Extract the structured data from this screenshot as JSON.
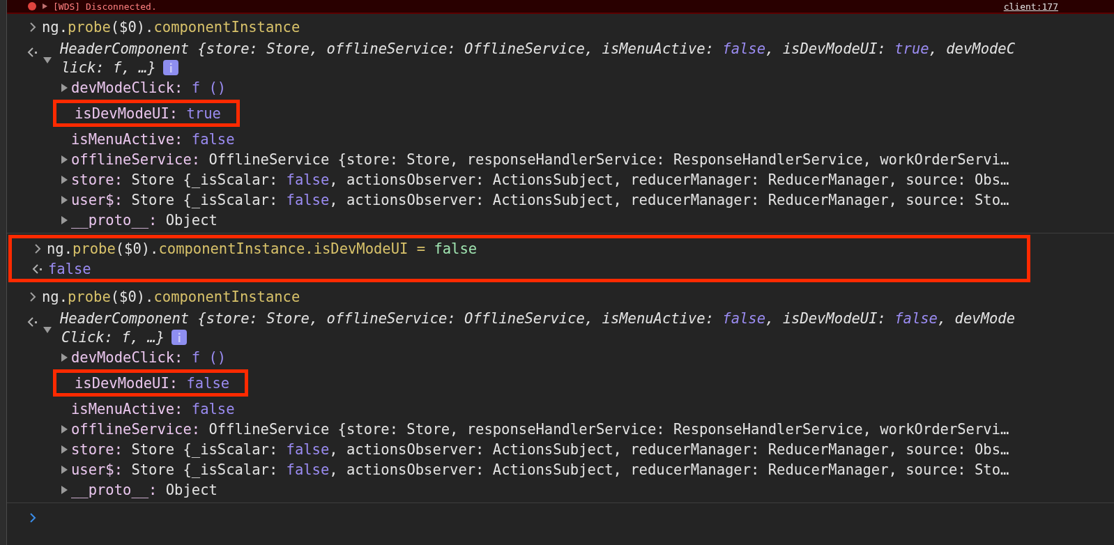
{
  "error_bar": {
    "message": "[WDS] Disconnected.",
    "source": "client:177"
  },
  "commands": [
    {
      "highlighted": false,
      "input": [
        {
          "text": "ng.",
          "kind": "plain"
        },
        {
          "text": "probe",
          "kind": "method"
        },
        {
          "text": "($0).",
          "kind": "plain"
        },
        {
          "text": "componentInstance",
          "kind": "method"
        }
      ],
      "output": {
        "kind": "object",
        "expanded": true,
        "summary_lines": [
          [
            {
              "text": "HeaderComponent {store: Store, offlineService: OfflineService, isMenuActive: ",
              "kind": "plain"
            },
            {
              "text": "false",
              "kind": "literal"
            },
            {
              "text": ", isDevModeUI: ",
              "kind": "plain"
            },
            {
              "text": "true",
              "kind": "literal"
            },
            {
              "text": ", devModeC",
              "kind": "plain"
            }
          ],
          [
            {
              "text": "lick: f, …}",
              "kind": "plain"
            }
          ]
        ],
        "properties": [
          {
            "name": "devModeClick:",
            "expandable": true,
            "highlighted": false,
            "value": [
              {
                "text": "f ()",
                "kind": "literal"
              }
            ]
          },
          {
            "name": "isDevModeUI:",
            "expandable": false,
            "highlighted": true,
            "value": [
              {
                "text": "true",
                "kind": "literal"
              }
            ]
          },
          {
            "name": "isMenuActive:",
            "expandable": false,
            "highlighted": false,
            "value": [
              {
                "text": "false",
                "kind": "literal"
              }
            ]
          },
          {
            "name": "offlineService:",
            "expandable": true,
            "highlighted": false,
            "value": [
              {
                "text": "OfflineService {store: Store, responseHandlerService: ResponseHandlerService, workOrderServi…",
                "kind": "plain"
              }
            ]
          },
          {
            "name": "store:",
            "expandable": true,
            "highlighted": false,
            "value": [
              {
                "text": "Store {_isScalar: ",
                "kind": "plain"
              },
              {
                "text": "false",
                "kind": "literal"
              },
              {
                "text": ", actionsObserver: ActionsSubject, reducerManager: ReducerManager, source: Obs…",
                "kind": "plain"
              }
            ]
          },
          {
            "name": "user$:",
            "expandable": true,
            "highlighted": false,
            "value": [
              {
                "text": "Store {_isScalar: ",
                "kind": "plain"
              },
              {
                "text": "false",
                "kind": "literal"
              },
              {
                "text": ", actionsObserver: ActionsSubject, reducerManager: ReducerManager, source: Sto…",
                "kind": "plain"
              }
            ]
          },
          {
            "name": "__proto__:",
            "expandable": true,
            "highlighted": false,
            "value": [
              {
                "text": "Object",
                "kind": "plain"
              }
            ]
          }
        ]
      }
    },
    {
      "highlighted": true,
      "input": [
        {
          "text": "ng.",
          "kind": "plain"
        },
        {
          "text": "probe",
          "kind": "method"
        },
        {
          "text": "($0).",
          "kind": "plain"
        },
        {
          "text": "componentInstance.isDevModeUI",
          "kind": "method"
        },
        {
          "text": " = ",
          "kind": "method"
        },
        {
          "text": "false",
          "kind": "assigned"
        }
      ],
      "output": {
        "kind": "value",
        "tokens": [
          {
            "text": "false",
            "kind": "literal"
          }
        ]
      }
    },
    {
      "highlighted": false,
      "input": [
        {
          "text": "ng.",
          "kind": "plain"
        },
        {
          "text": "probe",
          "kind": "method"
        },
        {
          "text": "($0).",
          "kind": "plain"
        },
        {
          "text": "componentInstance",
          "kind": "method"
        }
      ],
      "output": {
        "kind": "object",
        "expanded": true,
        "summary_lines": [
          [
            {
              "text": "HeaderComponent {store: Store, offlineService: OfflineService, isMenuActive: ",
              "kind": "plain"
            },
            {
              "text": "false",
              "kind": "literal"
            },
            {
              "text": ", isDevModeUI: ",
              "kind": "plain"
            },
            {
              "text": "false",
              "kind": "literal"
            },
            {
              "text": ", devMode",
              "kind": "plain"
            }
          ],
          [
            {
              "text": "Click: f, …}",
              "kind": "plain"
            }
          ]
        ],
        "properties": [
          {
            "name": "devModeClick:",
            "expandable": true,
            "highlighted": false,
            "value": [
              {
                "text": "f ()",
                "kind": "literal"
              }
            ]
          },
          {
            "name": "isDevModeUI:",
            "expandable": false,
            "highlighted": true,
            "value": [
              {
                "text": "false",
                "kind": "literal"
              }
            ]
          },
          {
            "name": "isMenuActive:",
            "expandable": false,
            "highlighted": false,
            "value": [
              {
                "text": "false",
                "kind": "literal"
              }
            ]
          },
          {
            "name": "offlineService:",
            "expandable": true,
            "highlighted": false,
            "value": [
              {
                "text": "OfflineService {store: Store, responseHandlerService: ResponseHandlerService, workOrderServi…",
                "kind": "plain"
              }
            ]
          },
          {
            "name": "store:",
            "expandable": true,
            "highlighted": false,
            "value": [
              {
                "text": "Store {_isScalar: ",
                "kind": "plain"
              },
              {
                "text": "false",
                "kind": "literal"
              },
              {
                "text": ", actionsObserver: ActionsSubject, reducerManager: ReducerManager, source: Obs…",
                "kind": "plain"
              }
            ]
          },
          {
            "name": "user$:",
            "expandable": true,
            "highlighted": false,
            "value": [
              {
                "text": "Store {_isScalar: ",
                "kind": "plain"
              },
              {
                "text": "false",
                "kind": "literal"
              },
              {
                "text": ", actionsObserver: ActionsSubject, reducerManager: ReducerManager, source: Sto…",
                "kind": "plain"
              }
            ]
          },
          {
            "name": "__proto__:",
            "expandable": true,
            "highlighted": false,
            "value": [
              {
                "text": "Object",
                "kind": "plain"
              }
            ]
          }
        ]
      }
    }
  ]
}
